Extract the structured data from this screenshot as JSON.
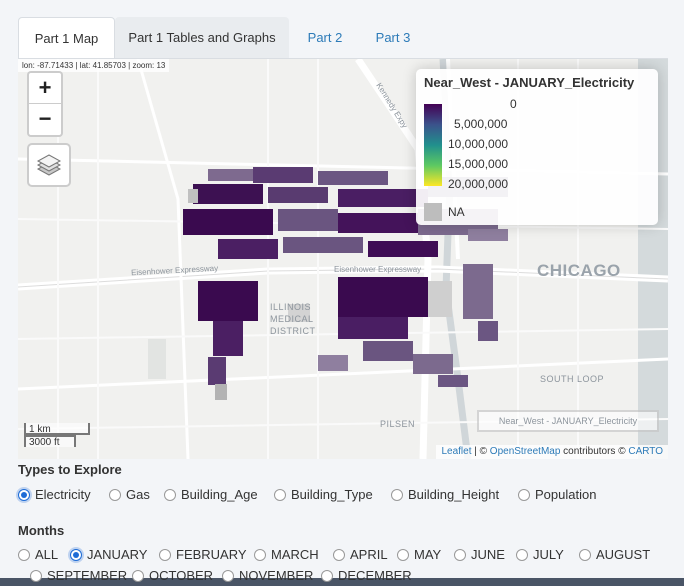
{
  "tabs": [
    {
      "label": "Part 1 Map",
      "state": "active"
    },
    {
      "label": "Part 1 Tables and Graphs",
      "state": "inactive"
    },
    {
      "label": "Part 2",
      "state": "link"
    },
    {
      "label": "Part 3",
      "state": "link"
    }
  ],
  "map": {
    "coords": "lon: -87.71433 | lat: 41.85703 | zoom: 13",
    "zoom_in": "+",
    "zoom_out": "−",
    "layers_icon": "layers-icon",
    "legend": {
      "title": "Near_West - JANUARY_Electricity",
      "labels": [
        "0",
        "5,000,000",
        "10,000,000",
        "15,000,000",
        "20,000,000"
      ],
      "na": "NA",
      "colors": [
        "#440154",
        "#3b528b",
        "#21908d",
        "#5dc962",
        "#fde725"
      ]
    },
    "labels": {
      "city": "CHICAGO",
      "medical": [
        "ILLINOIS",
        "MEDICAL",
        "DISTRICT"
      ],
      "south_loop": "SOUTH LOOP",
      "pilsen": "PILSEN",
      "eisenhower_west": "Eisenhower Expressway",
      "eisenhower_east": "Eisenhower Expressway",
      "kennedy": "Kennedy Expy"
    },
    "map_title": "Near_West - JANUARY_Electricity",
    "scale_km": "1 km",
    "scale_ft": "3000 ft",
    "attribution": {
      "leaflet": "Leaflet",
      "sep1": " | © ",
      "osm": "OpenStreetMap",
      "mid": " contributors © ",
      "carto": "CARTO"
    }
  },
  "types": {
    "label": "Types to Explore",
    "options": [
      "Electricity",
      "Gas",
      "Building_Age",
      "Building_Type",
      "Building_Height",
      "Population"
    ],
    "selected": "Electricity"
  },
  "months": {
    "label": "Months",
    "options_row1": [
      "ALL",
      "JANUARY",
      "FEBRUARY",
      "MARCH",
      "APRIL",
      "MAY",
      "JUNE",
      "JULY",
      "AUGUST"
    ],
    "options_row2": [
      "SEPTEMBER",
      "OCTOBER",
      "NOVEMBER",
      "DECEMBER"
    ],
    "selected": "JANUARY"
  }
}
